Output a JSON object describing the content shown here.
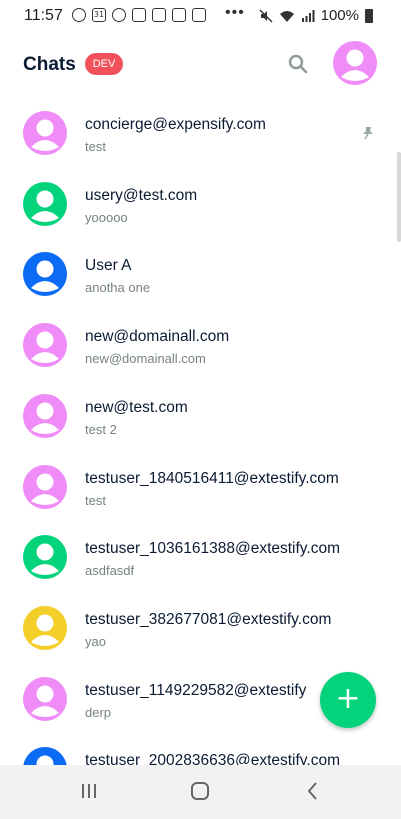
{
  "status": {
    "time": "11:57",
    "more": "•••",
    "battery": "100%",
    "icons": [
      "location-icon",
      "calendar-icon",
      "contact-icon",
      "image-icon",
      "flag-icon",
      "widget-icon",
      "nfc-icon"
    ]
  },
  "header": {
    "title": "Chats",
    "badge": "DEV"
  },
  "colors": {
    "pink": "#f08cf7",
    "green": "#03d47c",
    "blue": "#0b6bf5",
    "yellow": "#f4cf2a",
    "fab": "#03d47c",
    "badge": "#f2515c"
  },
  "chats": [
    {
      "name": "concierge@expensify.com",
      "sub": "test",
      "avatar_color": "pink",
      "pinned": true
    },
    {
      "name": "usery@test.com",
      "sub": "yooooo",
      "avatar_color": "green"
    },
    {
      "name": "User A",
      "sub": "anotha one",
      "avatar_color": "blue"
    },
    {
      "name": "new@domainall.com",
      "sub": "new@domainall.com",
      "avatar_color": "pink"
    },
    {
      "name": "new@test.com",
      "sub": "test 2",
      "avatar_color": "pink"
    },
    {
      "name": "testuser_1840516411@extestify.com",
      "sub": "test",
      "avatar_color": "pink"
    },
    {
      "name": "testuser_1036161388@extestify.com",
      "sub": "asdfasdf",
      "avatar_color": "green"
    },
    {
      "name": "testuser_382677081@extestify.com",
      "sub": "yao",
      "avatar_color": "yellow"
    },
    {
      "name": "testuser_1149229582@extestify",
      "sub": "derp",
      "avatar_color": "pink"
    },
    {
      "name": "testuser_2002836636@extestify.com",
      "sub": "",
      "avatar_color": "blue"
    }
  ],
  "fab": {
    "label": "+"
  }
}
